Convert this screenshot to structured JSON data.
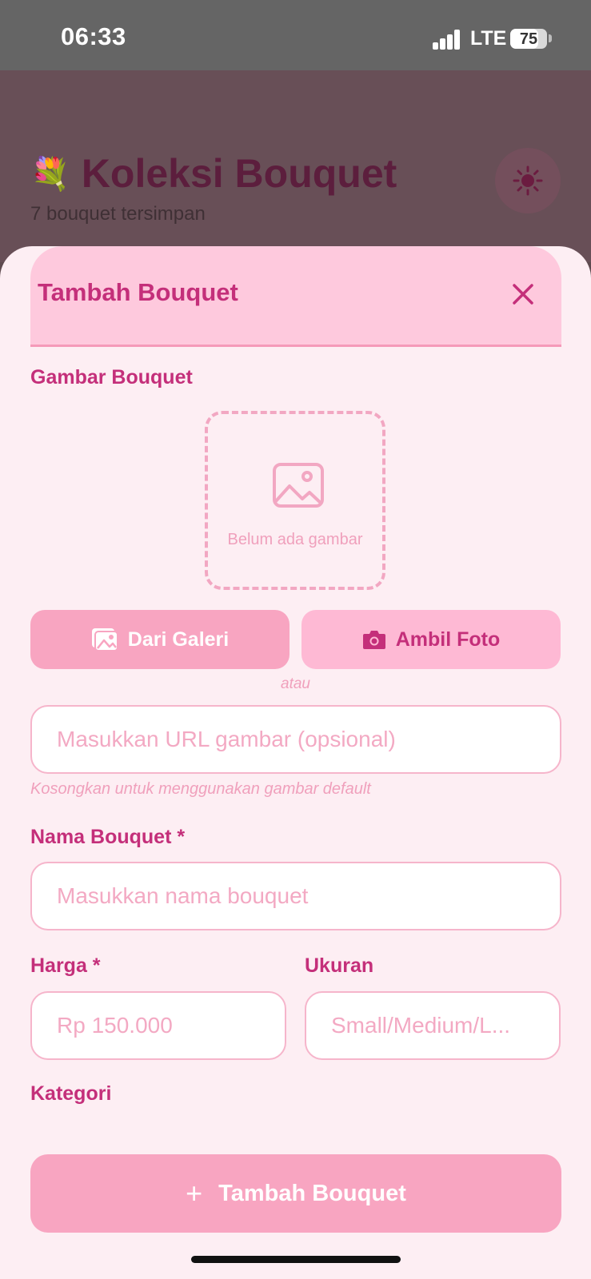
{
  "status_bar": {
    "time": "06:33",
    "network": "LTE",
    "battery": "75",
    "battery_level": 0.75
  },
  "app": {
    "emoji": "💐",
    "title": "Koleksi Bouquet",
    "subtitle": "7 bouquet tersimpan",
    "theme_icon": "sun-icon"
  },
  "modal": {
    "title": "Tambah Bouquet",
    "close_icon": "close-icon",
    "image_section": {
      "label": "Gambar Bouquet",
      "empty_text": "Belum ada gambar",
      "gallery_button": "Dari Galeri",
      "camera_button": "Ambil Foto",
      "or_text": "atau",
      "url_placeholder": "Masukkan URL gambar (opsional)",
      "url_value": "",
      "help_text": "Kosongkan untuk menggunakan gambar default"
    },
    "name": {
      "label": "Nama Bouquet *",
      "placeholder": "Masukkan nama bouquet",
      "value": ""
    },
    "price": {
      "label": "Harga *",
      "placeholder": "Rp 150.000",
      "value": ""
    },
    "size": {
      "label": "Ukuran",
      "placeholder": "Small/Medium/L...",
      "value": ""
    },
    "category": {
      "label": "Kategori"
    },
    "submit_button": "Tambah Bouquet",
    "submit_icon": "plus-icon"
  },
  "colors": {
    "accent": "#c42f7a",
    "header_bg": "#fec9dd",
    "sheet_bg": "#fdeef3",
    "button_pink": "#f8a5c1",
    "button_light_pink": "#feb9d4"
  }
}
